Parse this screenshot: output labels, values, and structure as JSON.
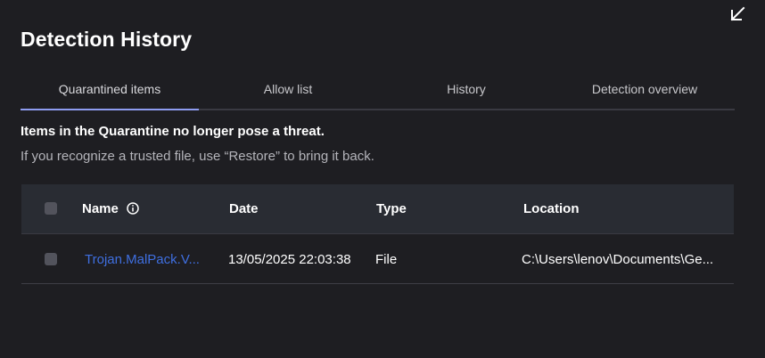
{
  "page": {
    "title": "Detection History"
  },
  "tabs": [
    {
      "label": "Quarantined items",
      "active": true
    },
    {
      "label": "Allow list",
      "active": false
    },
    {
      "label": "History",
      "active": false
    },
    {
      "label": "Detection overview",
      "active": false
    }
  ],
  "message": {
    "headline": "Items in the Quarantine no longer pose a threat.",
    "subtext": "If you recognize a trusted file, use “Restore” to bring it back."
  },
  "table": {
    "columns": {
      "name": "Name",
      "date": "Date",
      "type": "Type",
      "location": "Location"
    },
    "rows": [
      {
        "name": "Trojan.MalPack.V...",
        "date": "13/05/2025 22:03:38",
        "type": "File",
        "location": "C:\\Users\\lenov\\Documents\\Ge..."
      }
    ]
  },
  "icons": {
    "collapse": "collapse-arrow-icon",
    "info": "info-icon"
  },
  "colors": {
    "background": "#1e1e22",
    "header_bg": "#292c33",
    "accent": "#8e9cf0",
    "link": "#3f6fe0"
  }
}
